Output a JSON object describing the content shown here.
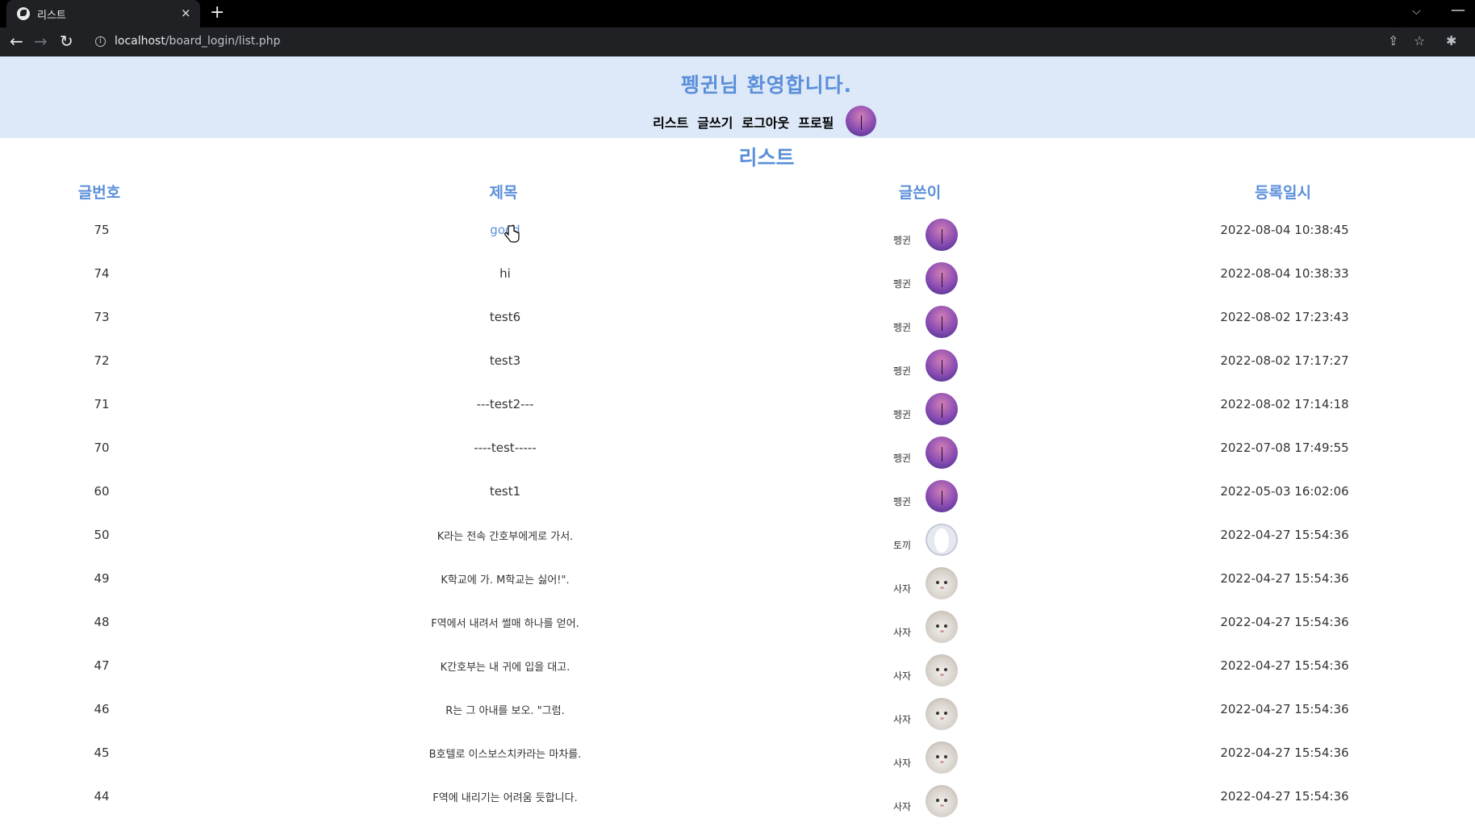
{
  "browser": {
    "tab_title": "리스트",
    "tab_close": "×",
    "new_tab": "+",
    "tab_list": "⌵",
    "minimize": "—",
    "back": "←",
    "forward": "→",
    "reload": "↻",
    "info": "i",
    "url_host": "localhost",
    "url_path": "/board_login/list.php",
    "share": "⇪",
    "bookmark": "☆",
    "extensions": "✱"
  },
  "header": {
    "welcome": "펭귄님 환영합니다.",
    "menu": [
      "리스트",
      "글쓰기",
      "로그아웃",
      "프로필"
    ]
  },
  "list": {
    "title": "리스트",
    "columns": {
      "num": "글번호",
      "title": "제목",
      "author": "글쓴이",
      "date": "등록일시"
    },
    "rows": [
      {
        "num": "75",
        "title": "good",
        "author": "펭귄",
        "date": "2022-08-04 10:38:45",
        "avatar": "purple"
      },
      {
        "num": "74",
        "title": "hi",
        "author": "펭귄",
        "date": "2022-08-04 10:38:33",
        "avatar": "purple"
      },
      {
        "num": "73",
        "title": "test6",
        "author": "펭귄",
        "date": "2022-08-02 17:23:43",
        "avatar": "purple"
      },
      {
        "num": "72",
        "title": "test3",
        "author": "펭귄",
        "date": "2022-08-02 17:17:27",
        "avatar": "purple"
      },
      {
        "num": "71",
        "title": "---test2---",
        "author": "펭귄",
        "date": "2022-08-02 17:14:18",
        "avatar": "purple"
      },
      {
        "num": "70",
        "title": "----test-----",
        "author": "펭귄",
        "date": "2022-07-08 17:49:55",
        "avatar": "purple"
      },
      {
        "num": "60",
        "title": "test1",
        "author": "펭귄",
        "date": "2022-05-03 16:02:06",
        "avatar": "purple"
      },
      {
        "num": "50",
        "title": "K라는 전속 간호부에게로 가서.",
        "author": "토끼",
        "date": "2022-04-27 15:54:36",
        "avatar": "blank"
      },
      {
        "num": "49",
        "title": "K학교에 가. M학교는 싫어!\".",
        "author": "사자",
        "date": "2022-04-27 15:54:36",
        "avatar": "cat"
      },
      {
        "num": "48",
        "title": "F역에서 내려서 썰매 하나를 얻어.",
        "author": "사자",
        "date": "2022-04-27 15:54:36",
        "avatar": "cat"
      },
      {
        "num": "47",
        "title": "K간호부는 내 귀에 입을 대고.",
        "author": "사자",
        "date": "2022-04-27 15:54:36",
        "avatar": "cat"
      },
      {
        "num": "46",
        "title": "R는 그 아내를 보오. \"그럼.",
        "author": "사자",
        "date": "2022-04-27 15:54:36",
        "avatar": "cat"
      },
      {
        "num": "45",
        "title": "B호텔로 이스보스치카라는 마차를.",
        "author": "사자",
        "date": "2022-04-27 15:54:36",
        "avatar": "cat"
      },
      {
        "num": "44",
        "title": "F역에 내리기는 어려움 듯합니다.",
        "author": "사자",
        "date": "2022-04-27 15:54:36",
        "avatar": "cat"
      }
    ]
  }
}
